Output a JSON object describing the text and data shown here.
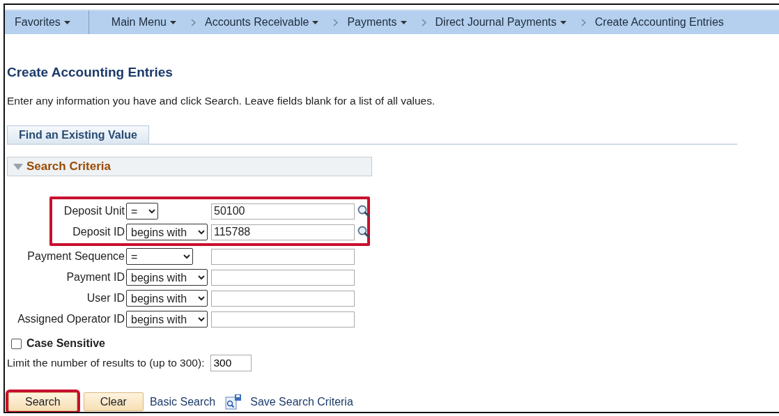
{
  "nav": {
    "items": [
      {
        "label": "Favorites",
        "kind": "menu"
      },
      {
        "label": "Main Menu",
        "kind": "menu"
      },
      {
        "label": "Accounts Receivable",
        "kind": "menu"
      },
      {
        "label": "Payments",
        "kind": "menu"
      },
      {
        "label": "Direct Journal Payments",
        "kind": "menu"
      },
      {
        "label": "Create Accounting Entries",
        "kind": "page"
      }
    ]
  },
  "title": "Create Accounting Entries",
  "instructions": "Enter any information you have and click Search. Leave fields blank for a list of all values.",
  "tabs": [
    {
      "label": "Find an Existing Value",
      "selected": true
    }
  ],
  "section": {
    "title": "Search Criteria",
    "expanded": true
  },
  "criteria": [
    {
      "label": "Deposit Unit",
      "operator": "=",
      "value": "50100",
      "lookup": true,
      "highlighted": true
    },
    {
      "label": "Deposit ID",
      "operator": "begins with",
      "value": "115788",
      "lookup": true,
      "highlighted": true
    },
    {
      "label": "Payment Sequence",
      "operator": "=",
      "lookup": false,
      "highlighted": false
    },
    {
      "label": "Payment ID",
      "operator": "begins with",
      "lookup": false,
      "highlighted": false
    },
    {
      "label": "User ID",
      "operator": "begins with",
      "lookup": false,
      "highlighted": false
    },
    {
      "label": "Assigned Operator ID",
      "operator": "begins with",
      "lookup": false,
      "highlighted": false
    }
  ],
  "case_sensitive": {
    "label": "Case Sensitive",
    "checked": false
  },
  "limit": {
    "label": "Limit the number of results to (up to 300):",
    "value": "300"
  },
  "actions": [
    {
      "label": "Search",
      "kind": "button",
      "highlighted": true
    },
    {
      "label": "Clear",
      "kind": "button",
      "highlighted": false
    },
    {
      "label": "Basic Search",
      "kind": "link"
    },
    {
      "label": "Save Search Criteria",
      "kind": "save-link"
    }
  ]
}
